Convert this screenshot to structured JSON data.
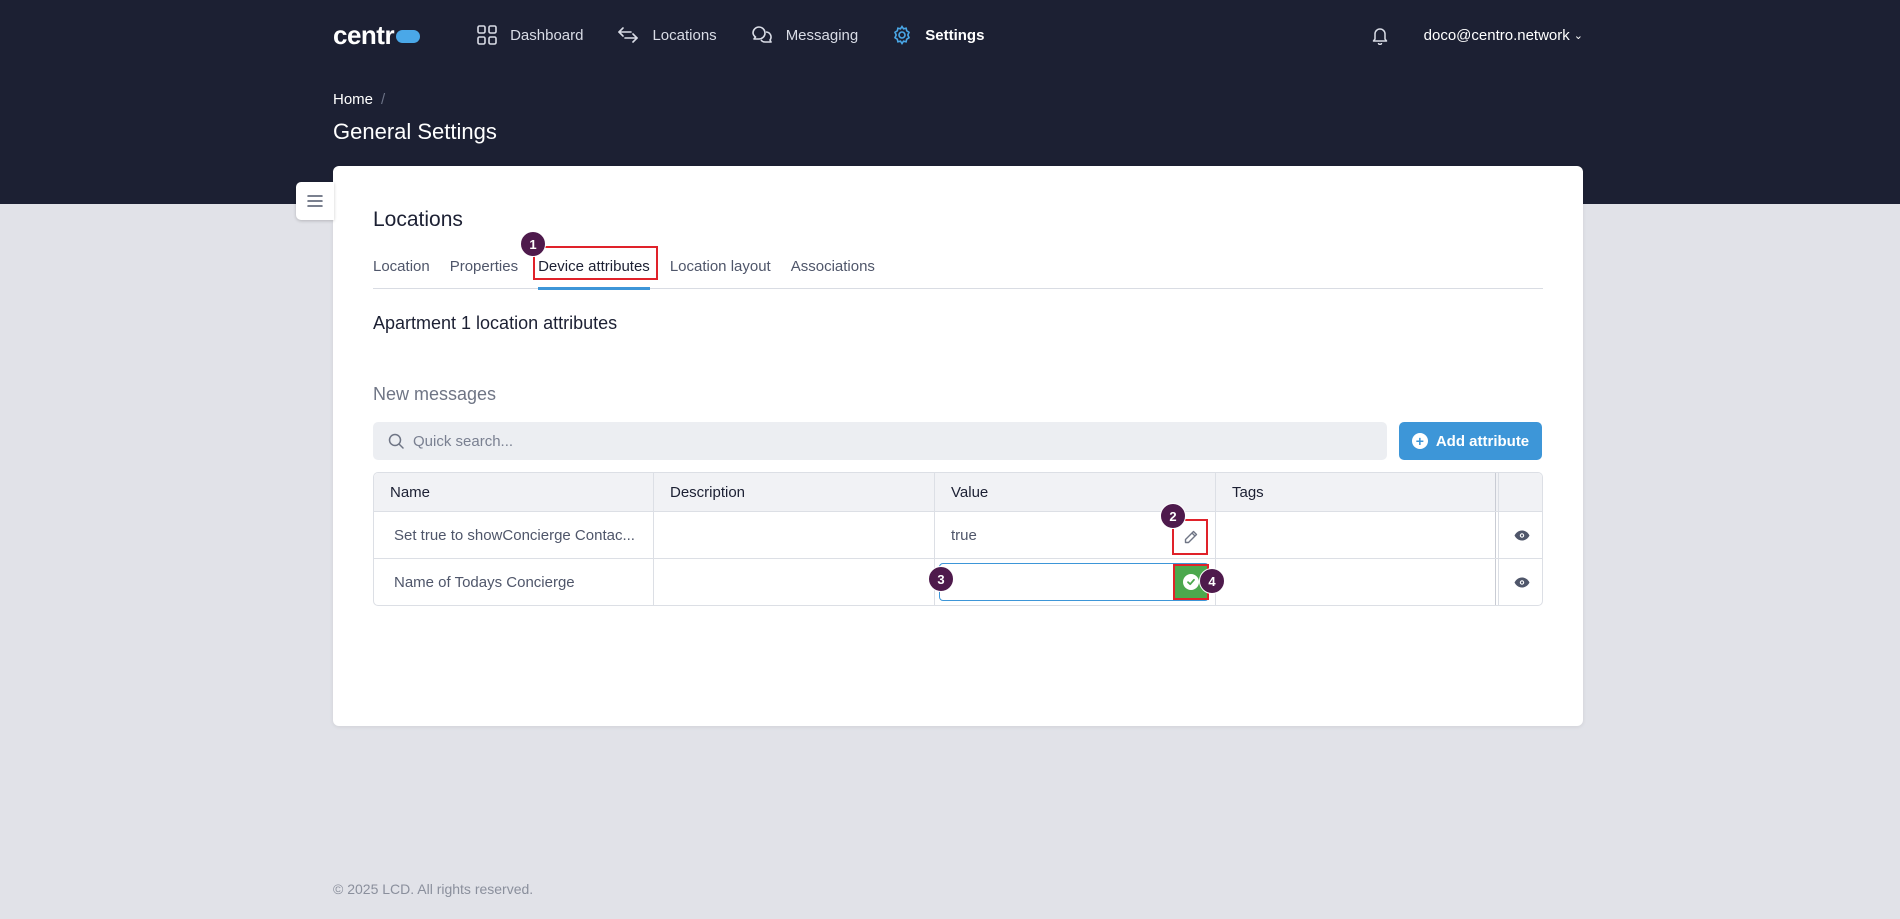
{
  "header": {
    "logo": "centr",
    "nav": [
      {
        "label": "Dashboard",
        "icon": "dashboard-grid-icon"
      },
      {
        "label": "Locations",
        "icon": "arrows-exchange-icon"
      },
      {
        "label": "Messaging",
        "icon": "chat-bubbles-icon"
      },
      {
        "label": "Settings",
        "icon": "gear-icon",
        "active": true
      }
    ],
    "user_email": "doco@centro.network"
  },
  "breadcrumb": {
    "home": "Home",
    "separator": "/"
  },
  "page_title": "General Settings",
  "card": {
    "title": "Locations",
    "tabs": [
      "Location",
      "Properties",
      "Device attributes",
      "Location layout",
      "Associations"
    ],
    "active_tab": "Device attributes",
    "subtitle": "Apartment 1 location attributes",
    "section_title": "New messages",
    "search_placeholder": "Quick search...",
    "add_button": "Add attribute",
    "table": {
      "columns": [
        "Name",
        "Description",
        "Value",
        "Tags"
      ],
      "rows": [
        {
          "name": "Set true to showConcierge Contac...",
          "description": "",
          "value": "true",
          "tags": ""
        },
        {
          "name": "Name of Todays Concierge",
          "description": "",
          "value": "",
          "tags": ""
        }
      ]
    }
  },
  "annotations": [
    "1",
    "2",
    "3",
    "4"
  ],
  "footer": "© 2025 LCD. All rights reserved.",
  "colors": {
    "header_bg": "#1c2033",
    "accent": "#3d96d8",
    "confirm": "#4ca84d",
    "highlight": "#e0222a",
    "badge": "#4e1a4c"
  }
}
